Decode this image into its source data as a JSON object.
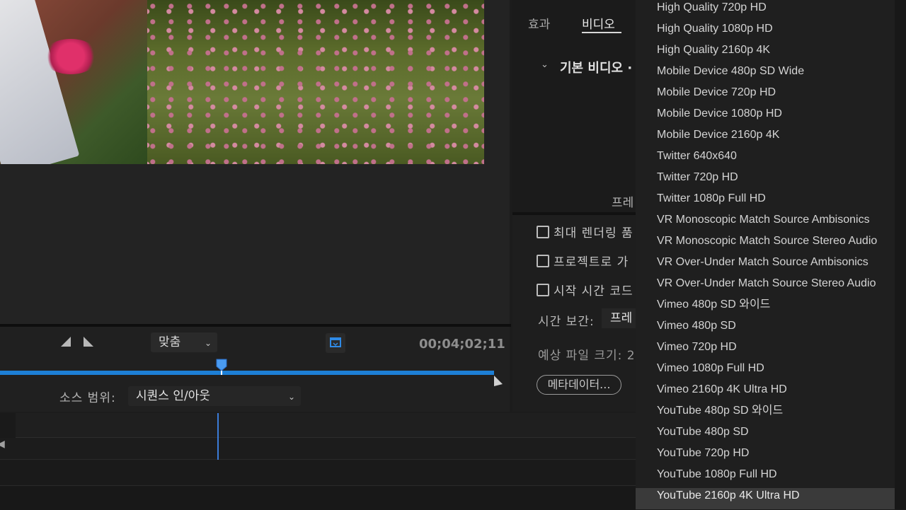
{
  "preview": {
    "fit_label": "맞춤",
    "timecode": "00;04;02;11",
    "source_range_label": "소스 범위:",
    "source_range_value": "시퀀스 인/아웃"
  },
  "settings": {
    "tabs": [
      "효과",
      "비디오"
    ],
    "active_tab": "비디오",
    "basic_video_heading": "기본 비디오 ·",
    "frame_label_partial": "프레",
    "checkboxes": [
      {
        "label": "최대 렌더링 품",
        "checked": false
      },
      {
        "label": "프로젝트로 가",
        "checked": false
      },
      {
        "label": "시작 시간 코드",
        "checked": false
      }
    ],
    "time_interp_label": "시간 보간:",
    "time_interp_value": "프레",
    "file_size_label": "예상 파일 크기: 2",
    "metadata_button": "메타데이터..."
  },
  "preset_menu": {
    "items": [
      "High Quality 720p HD",
      "High Quality 1080p HD",
      "High Quality 2160p 4K",
      "Mobile Device 480p SD Wide",
      "Mobile Device 720p HD",
      "Mobile Device 1080p HD",
      "Mobile Device 2160p 4K",
      "Twitter 640x640",
      "Twitter 720p HD",
      "Twitter 1080p Full HD",
      "VR Monoscopic Match Source Ambisonics",
      "VR Monoscopic Match Source Stereo Audio",
      "VR Over-Under Match Source Ambisonics",
      "VR Over-Under Match Source Stereo Audio",
      "Vimeo 480p SD 와이드",
      "Vimeo 480p SD",
      "Vimeo 720p HD",
      "Vimeo 1080p Full HD",
      "Vimeo 2160p 4K Ultra HD",
      "YouTube 480p SD 와이드",
      "YouTube 480p SD",
      "YouTube 720p HD",
      "YouTube 1080p Full HD",
      "YouTube 2160p 4K Ultra HD"
    ],
    "selected": "YouTube 2160p 4K Ultra HD"
  },
  "colors": {
    "accent_blue": "#1d7fd6",
    "selected_bg": "#3a3a3a"
  }
}
